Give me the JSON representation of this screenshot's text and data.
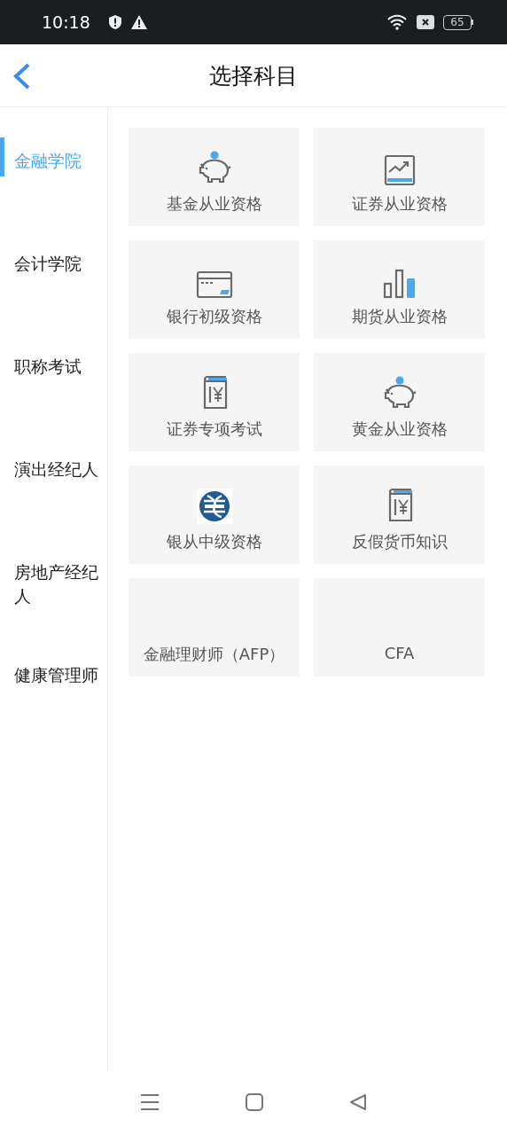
{
  "status_bar": {
    "time": "10:18",
    "battery": "65"
  },
  "header": {
    "title": "选择科目"
  },
  "sidebar": {
    "items": [
      {
        "label": "金融学院",
        "selected": true
      },
      {
        "label": "会计学院",
        "selected": false
      },
      {
        "label": "职称考试",
        "selected": false
      },
      {
        "label": "演出经纪人",
        "selected": false
      },
      {
        "label": "房地产经纪人",
        "selected": false
      },
      {
        "label": "健康管理师",
        "selected": false
      }
    ]
  },
  "subjects": [
    {
      "label": "基金从业资格",
      "kind": "piggy"
    },
    {
      "label": "证券从业资格",
      "kind": "chart"
    },
    {
      "label": "银行初级资格",
      "kind": "card"
    },
    {
      "label": "期货从业资格",
      "kind": "bars"
    },
    {
      "label": "证券专项考试",
      "kind": "book"
    },
    {
      "label": "黄金从业资格",
      "kind": "piggy"
    },
    {
      "label": "银从中级资格",
      "kind": "emblem"
    },
    {
      "label": "反假货币知识",
      "kind": "book"
    },
    {
      "label": "金融理财师（AFP）",
      "kind": "none"
    },
    {
      "label": "CFA",
      "kind": "none"
    }
  ]
}
